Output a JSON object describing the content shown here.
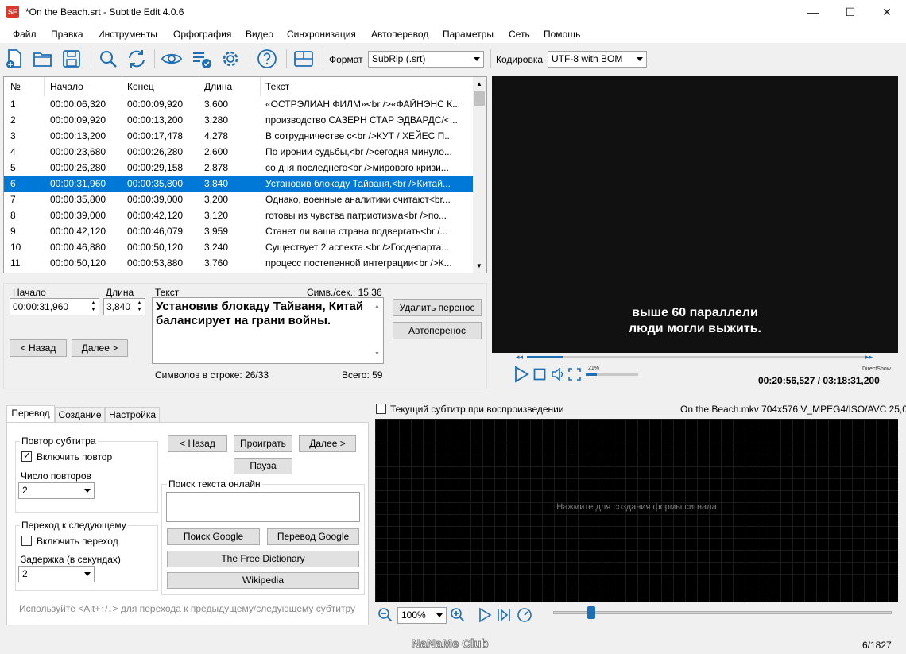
{
  "window": {
    "title": "*On the Beach.srt - Subtitle Edit 4.0.6",
    "app_icon": "SE",
    "minimize": "—",
    "maximize": "☐",
    "close": "✕"
  },
  "menu": [
    "Файл",
    "Правка",
    "Инструменты",
    "Орфография",
    "Видео",
    "Синхронизация",
    "Автоперевод",
    "Параметры",
    "Сеть",
    "Помощь"
  ],
  "toolbar": {
    "icons": [
      "new-file-icon",
      "open-folder-icon",
      "save-icon",
      "find-icon",
      "replace-icon",
      "visual-sync-icon",
      "spell-check-icon",
      "settings-icon",
      "help-icon",
      "layout-icon"
    ],
    "format_label": "Формат",
    "format_value": "SubRip (.srt)",
    "encoding_label": "Кодировка",
    "encoding_value": "UTF-8 with BOM"
  },
  "grid": {
    "columns": [
      "№",
      "Начало",
      "Конец",
      "Длина",
      "Текст"
    ],
    "rows": [
      {
        "n": "1",
        "start": "00:00:06,320",
        "end": "00:00:09,920",
        "dur": "3,600",
        "text": "«ОСТРЭЛИАН ФИЛМ»<br />«ФАЙНЭНС К..."
      },
      {
        "n": "2",
        "start": "00:00:09,920",
        "end": "00:00:13,200",
        "dur": "3,280",
        "text": "производство САЗЕРН СТАР ЭДВАРДС/<..."
      },
      {
        "n": "3",
        "start": "00:00:13,200",
        "end": "00:00:17,478",
        "dur": "4,278",
        "text": "В сотрудничестве с<br />КУТ / ХЕЙЕС П..."
      },
      {
        "n": "4",
        "start": "00:00:23,680",
        "end": "00:00:26,280",
        "dur": "2,600",
        "text": "По иронии судьбы,<br />сегодня минуло..."
      },
      {
        "n": "5",
        "start": "00:00:26,280",
        "end": "00:00:29,158",
        "dur": "2,878",
        "text": "со дня последнего<br />мирового кризи..."
      },
      {
        "n": "6",
        "start": "00:00:31,960",
        "end": "00:00:35,800",
        "dur": "3,840",
        "text": "Установив блокаду Тайваня,<br />Китай..."
      },
      {
        "n": "7",
        "start": "00:00:35,800",
        "end": "00:00:39,000",
        "dur": "3,200",
        "text": "Однако, военные аналитики считают<br..."
      },
      {
        "n": "8",
        "start": "00:00:39,000",
        "end": "00:00:42,120",
        "dur": "3,120",
        "text": "готовы из чувства патриотизма<br />по..."
      },
      {
        "n": "9",
        "start": "00:00:42,120",
        "end": "00:00:46,079",
        "dur": "3,959",
        "text": "Станет ли ваша страна подвергать<br /..."
      },
      {
        "n": "10",
        "start": "00:00:46,880",
        "end": "00:00:50,120",
        "dur": "3,240",
        "text": "Существует 2 аспекта.<br />Госдепарта..."
      },
      {
        "n": "11",
        "start": "00:00:50,120",
        "end": "00:00:53,880",
        "dur": "3,760",
        "text": "процесс постепенной интеграции<br />К..."
      }
    ],
    "selected_index": 5
  },
  "edit": {
    "start_label": "Начало",
    "start_value": "00:00:31,960",
    "dur_label": "Длина",
    "dur_value": "3,840",
    "text_label": "Текст",
    "cps": "Симв./сек.: 15,36",
    "text_value": "Установив блокаду Тайваня, Китай балансирует на грани войны.",
    "prev": "< Назад",
    "next": "Далее >",
    "remove_break": "Удалить перенос",
    "auto_break": "Автоперенос",
    "line_chars": "Символов в строке: 26/33",
    "total": "Всего: 59"
  },
  "video": {
    "subtitle_line1": "выше 60 параллели",
    "subtitle_line2": "люди могли выжить.",
    "volume": "21%",
    "engine": "DirectShow",
    "time": "00:20:56,527 / 03:18:31,200",
    "progress": 0.105
  },
  "tabs": [
    "Перевод",
    "Создание",
    "Настройка"
  ],
  "translate": {
    "repeat_group": "Повтор субтитра",
    "enable_repeat": "Включить повтор",
    "repeat_count_label": "Число повторов",
    "repeat_count": "2",
    "next_group": "Переход к следующему",
    "enable_next": "Включить переход",
    "delay_label": "Задержка (в секундах)",
    "delay": "2",
    "back": "< Назад",
    "play": "Проиграть",
    "forward": "Далее >",
    "pause": "Пауза",
    "search_group": "Поиск текста онлайн",
    "google_search": "Поиск Google",
    "google_translate": "Перевод Google",
    "free_dict": "The Free Dictionary",
    "wikipedia": "Wikipedia",
    "hint": "Используйте <Alt+↑/↓> для перехода к предыдущему/следующему субтитру"
  },
  "waveform": {
    "current_sub_checkbox": "Текущий субтитр при воспроизведении",
    "media_info": "On the Beach.mkv 704x576 V_MPEG4/ISO/AVC 25,0",
    "message": "Нажмите для создания формы сигнала",
    "zoom": "100%"
  },
  "status": {
    "watermark": "NaNaMe Club",
    "position": "6/1827"
  }
}
